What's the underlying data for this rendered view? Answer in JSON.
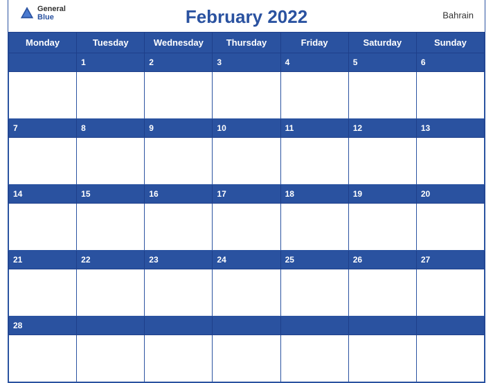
{
  "header": {
    "title": "February 2022",
    "country": "Bahrain",
    "logo": {
      "general": "General",
      "blue": "Blue"
    }
  },
  "days_of_week": [
    "Monday",
    "Tuesday",
    "Wednesday",
    "Thursday",
    "Friday",
    "Saturday",
    "Sunday"
  ],
  "weeks": [
    {
      "header": [
        "",
        "1",
        "2",
        "3",
        "4",
        "5",
        "6"
      ]
    },
    {
      "header": [
        "7",
        "8",
        "9",
        "10",
        "11",
        "12",
        "13"
      ]
    },
    {
      "header": [
        "14",
        "15",
        "16",
        "17",
        "18",
        "19",
        "20"
      ]
    },
    {
      "header": [
        "21",
        "22",
        "23",
        "24",
        "25",
        "26",
        "27"
      ]
    },
    {
      "header": [
        "28",
        "",
        "",
        "",
        "",
        "",
        ""
      ]
    }
  ],
  "colors": {
    "primary": "#2a52a0",
    "white": "#ffffff",
    "text_dark": "#333333"
  }
}
